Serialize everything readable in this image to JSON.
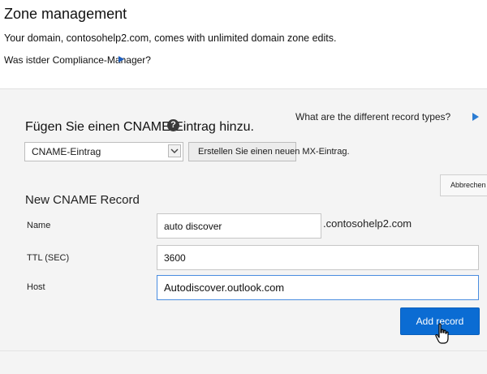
{
  "header": {
    "title": "Zone management",
    "domain_text": "Your domain, contosohelp2.com, comes with unlimited domain zone edits.",
    "compliance_link": "Was istder Compliance-Manager?"
  },
  "panel": {
    "record_types_link": "What are the different record types?",
    "add_record_title": "Fügen Sie einen CNAME-Eintrag hinzu.",
    "record_type_select": {
      "value": "CNAME-Eintrag"
    },
    "create_mx_button": "Erstellen Sie einen neuen MX-Eintrag.",
    "cancel_button": "Abbrechen"
  },
  "form": {
    "title": "New CNAME Record",
    "name_label": "Name",
    "name_value": "auto discover",
    "domain_suffix": ".contosohelp2.com",
    "ttl_label": "TTL (SEC)",
    "ttl_value": "3600",
    "host_label": "Host",
    "host_value": "Autodiscover.outlook.com",
    "add_button": "Add record"
  },
  "icons": [
    "help-icon",
    "chevron-down-icon",
    "play-arrow-icon",
    "pointer-arrow-icon",
    "hand-cursor-icon"
  ],
  "colors": {
    "accent": "#0b6cd3",
    "focus_border": "#4a8de0",
    "panel_bg": "#f4f4f4"
  }
}
